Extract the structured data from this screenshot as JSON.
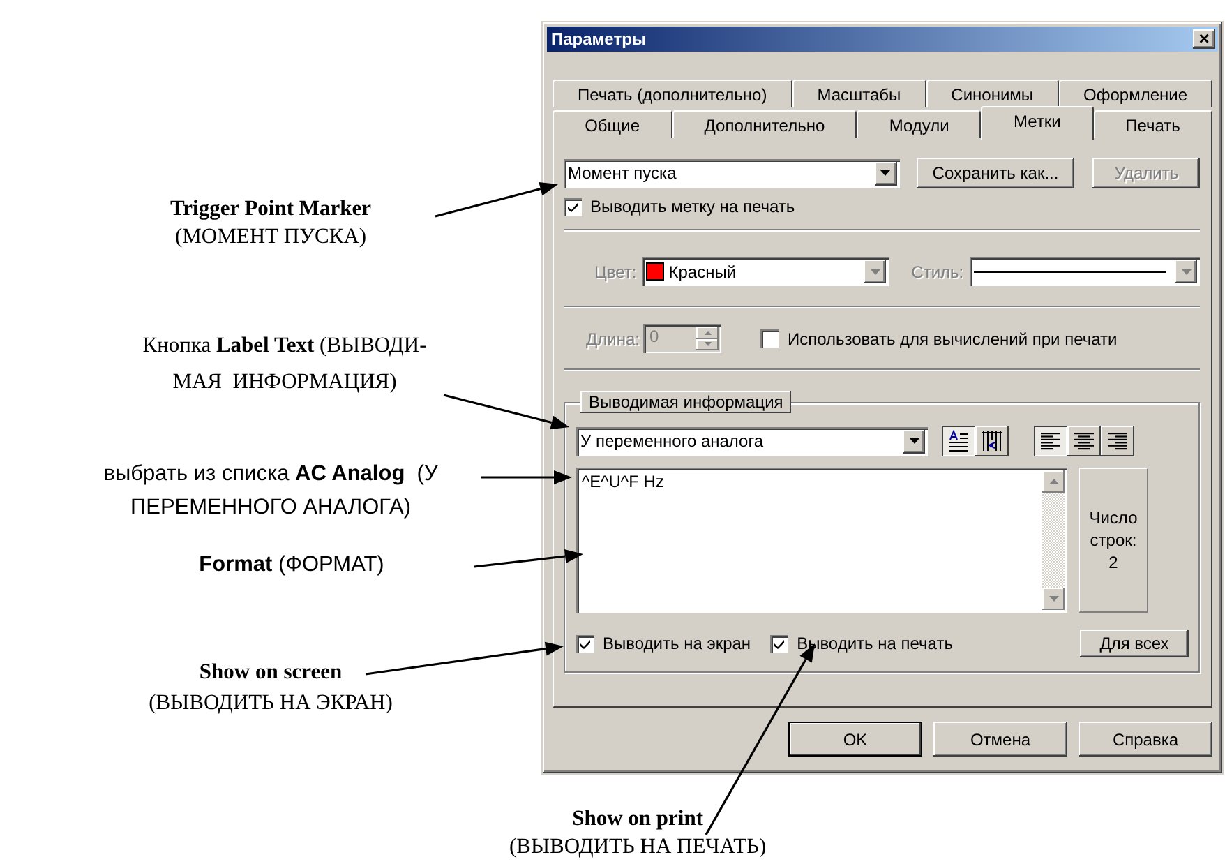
{
  "dialog": {
    "title": "Параметры",
    "close": "×",
    "tab_rows": [
      [
        {
          "label": "Печать (дополнительно)",
          "selected": false
        },
        {
          "label": "Масштабы",
          "selected": false
        },
        {
          "label": "Синонимы",
          "selected": false
        },
        {
          "label": "Оформление",
          "selected": false
        }
      ],
      [
        {
          "label": "Общие",
          "selected": false
        },
        {
          "label": "Дополнительно",
          "selected": false
        },
        {
          "label": "Модули",
          "selected": false
        },
        {
          "label": "Метки",
          "selected": true
        },
        {
          "label": "Печать",
          "selected": false
        }
      ]
    ],
    "marker": {
      "value": "Момент пуска",
      "save_button": "Сохранить как...",
      "delete_button": {
        "label": "Удалить",
        "disabled": true
      }
    },
    "print_marker": {
      "label": "Выводить метку на печать",
      "checked": true
    },
    "color": {
      "label": "Цвет:",
      "value": "Красный",
      "color": "#ff0000",
      "disabled": true
    },
    "style": {
      "label": "Стиль:",
      "disabled": true
    },
    "length": {
      "label": "Длина:",
      "value": "0",
      "disabled": true
    },
    "use_for_calc": {
      "label": "Использовать для вычислений при печати",
      "checked": false
    },
    "info_group": {
      "button": "Выводимая информация",
      "source": "У переменного аналога",
      "text_mode_buttons": [
        {
          "kind": "horizontal",
          "selected": true
        },
        {
          "kind": "vertical",
          "selected": false
        }
      ],
      "alignment_buttons": [
        {
          "kind": "left",
          "selected": true
        },
        {
          "kind": "center",
          "selected": false
        },
        {
          "kind": "right",
          "selected": false
        }
      ],
      "format": "^E^U^F Hz",
      "line_count_label": "Число строк:",
      "line_count": "2",
      "show_on_screen": {
        "label": "Выводить на экран",
        "checked": true
      },
      "show_on_print": {
        "label": "Выводить на печать",
        "checked": true
      },
      "for_all": "Для всех"
    },
    "buttons": [
      {
        "label": "OK",
        "default": true
      },
      {
        "label": "Отмена",
        "default": false
      },
      {
        "label": "Справка",
        "default": false
      }
    ]
  },
  "annotations": [
    {
      "kind": "term",
      "lines": [
        {
          "text": "Trigger Point Marker",
          "bold": true
        },
        {
          "text": "(МОМЕНТ ПУСКА)",
          "bold": false
        }
      ]
    },
    {
      "kind": "term",
      "lines": [
        {
          "text": "Кнопка **Label Text** (ВЫВОДИ-",
          "bold": false
        },
        {
          "text": "МАЯ  ИНФОРМАЦИЯ)",
          "bold": false
        }
      ]
    },
    {
      "kind": "action",
      "lines": [
        {
          "text": "выбрать из списка **AC Analog**  (У",
          "bold": false
        },
        {
          "text": "ПЕРЕМЕННОГО АНАЛОГА)",
          "bold": false
        }
      ]
    },
    {
      "kind": "action",
      "lines": [
        {
          "text": "**Format** (ФОРМАТ)",
          "bold": false
        }
      ]
    },
    {
      "kind": "term",
      "lines": [
        {
          "text": "Show on screen",
          "bold": true
        },
        {
          "text": "(ВЫВОДИТЬ НА ЭКРАН)",
          "bold": false
        }
      ]
    },
    {
      "kind": "term",
      "lines": [
        {
          "text": "Show on print",
          "bold": true
        },
        {
          "text": "(ВЫВОДИТЬ НА ПЕЧАТЬ)",
          "bold": false
        }
      ]
    }
  ]
}
